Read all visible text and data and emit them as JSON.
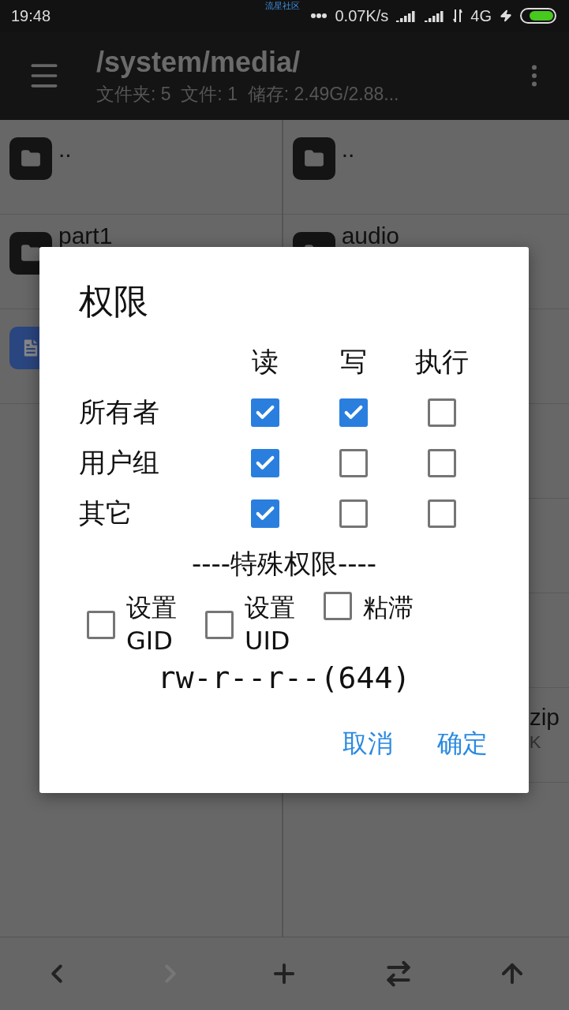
{
  "status_bar": {
    "time": "19:48",
    "carrier": "流星社区",
    "speed": "0.07K/s",
    "network": "4G"
  },
  "toolbar": {
    "title": "/system/media/",
    "subtitle": "文件夹: 5  文件: 1  储存: 2.49G/2.88..."
  },
  "left_pane": [
    {
      "kind": "folder",
      "name": ".."
    },
    {
      "kind": "folder",
      "name": "part1"
    },
    {
      "kind": "file"
    }
  ],
  "right_pane": [
    {
      "kind": "folder",
      "name": ".."
    },
    {
      "kind": "folder",
      "name": "audio"
    },
    {
      "kind": "empty"
    },
    {
      "kind": "empty"
    },
    {
      "kind": "empty"
    },
    {
      "kind": "empty"
    },
    {
      "kind": "partial",
      "name": "zip",
      "detail": "K"
    }
  ],
  "dialog": {
    "title": "权限",
    "columns": [
      "读",
      "写",
      "执行"
    ],
    "rows": [
      {
        "label": "所有者",
        "checks": [
          true,
          true,
          false
        ]
      },
      {
        "label": "用户组",
        "checks": [
          true,
          false,
          false
        ]
      },
      {
        "label": "其它",
        "checks": [
          true,
          false,
          false
        ]
      }
    ],
    "special_title": "----特殊权限----",
    "specials": [
      {
        "label": "设置 GID",
        "checked": false
      },
      {
        "label": "设置 UID",
        "checked": false
      },
      {
        "label": "粘滞",
        "checked": false
      }
    ],
    "mode": "rw-r--r--(644)",
    "buttons": [
      "取消",
      "确定"
    ]
  },
  "bottom_bar": [
    {
      "kind": "back",
      "disabled": false
    },
    {
      "kind": "forward",
      "disabled": true
    },
    {
      "kind": "add",
      "disabled": false
    },
    {
      "kind": "swap",
      "disabled": false
    },
    {
      "kind": "up",
      "disabled": false
    }
  ]
}
